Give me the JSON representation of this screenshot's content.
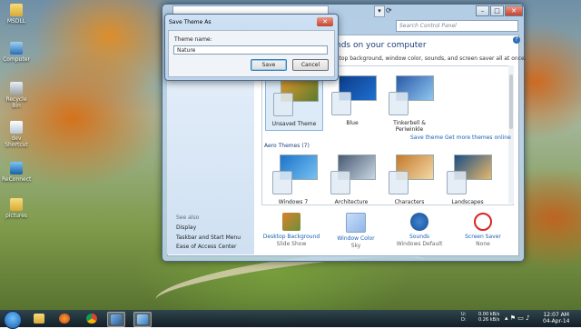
{
  "desktop": {
    "icons": [
      {
        "label": "MSDLL",
        "icon": "folder-icon"
      },
      {
        "label": "Computer",
        "icon": "computer-icon"
      },
      {
        "label": "Recycle Bin",
        "icon": "recycle-bin-icon"
      },
      {
        "label": "dev Shortcut",
        "icon": "shortcut-icon"
      },
      {
        "label": "ReConnect",
        "icon": "network-icon"
      },
      {
        "label": "pictures",
        "icon": "folder-icon"
      }
    ]
  },
  "window": {
    "search_placeholder": "Search Control Panel",
    "heading": "nds on your computer",
    "subheading": "ktop background, window color, sounds, and screen saver all at once.",
    "help": "?",
    "themes_my": [
      {
        "label": "Unsaved Theme",
        "selected": true
      },
      {
        "label": "Blue",
        "selected": false
      },
      {
        "label": "Tinkerbell & Periwinkle",
        "selected": false
      }
    ],
    "save_theme_link": "Save theme",
    "get_more_link": "Get more themes online",
    "aero_label": "Aero Themes (7)",
    "themes_aero": [
      {
        "label": "Windows 7"
      },
      {
        "label": "Architecture"
      },
      {
        "label": "Characters"
      },
      {
        "label": "Landscapes"
      }
    ],
    "see_also": {
      "title": "See also",
      "items": [
        "Display",
        "Taskbar and Start Menu",
        "Ease of Access Center"
      ]
    },
    "bottom_items": [
      {
        "label": "Desktop Background",
        "value": "Slide Show"
      },
      {
        "label": "Window Color",
        "value": "Sky"
      },
      {
        "label": "Sounds",
        "value": "Windows Default"
      },
      {
        "label": "Screen Saver",
        "value": "None"
      }
    ]
  },
  "dialog": {
    "title": "Save Theme As",
    "close": "✕",
    "field_label": "Theme name:",
    "field_value": "Nature",
    "save_label": "Save",
    "cancel_label": "Cancel"
  },
  "taskbar": {
    "apps": [
      "file-explorer-icon",
      "firefox-icon",
      "chrome-icon",
      "personalize-icon",
      "control-panel-icon"
    ],
    "net_up_label": "U:",
    "net_up": "0.00 kB/s",
    "net_down_label": "D:",
    "net_down": "0.26 kB/s",
    "time": "12:07 AM",
    "date": "04-Apr-14"
  }
}
